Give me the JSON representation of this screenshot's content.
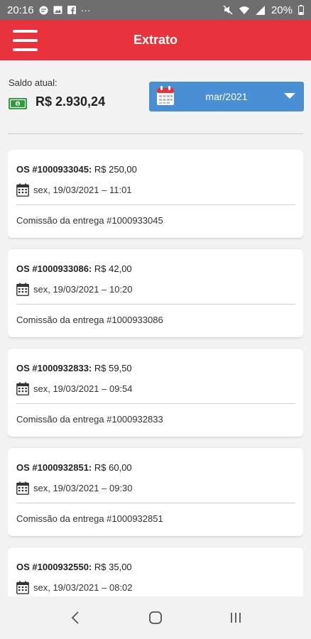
{
  "status_bar": {
    "time": "20:16",
    "more": "···",
    "battery": "20%"
  },
  "header": {
    "title": "Extrato"
  },
  "balance": {
    "label": "Saldo atual:",
    "value": "R$ 2.930,24"
  },
  "month_picker": {
    "selected": "mar/2021"
  },
  "entries": [
    {
      "os": "OS #1000933045:",
      "amount": "R$ 250,00",
      "date": "sex, 19/03/2021 – 11:01",
      "description": "Comissão da entrega #1000933045"
    },
    {
      "os": "OS #1000933086:",
      "amount": "R$ 42,00",
      "date": "sex, 19/03/2021 – 10:20",
      "description": "Comissão da entrega #1000933086"
    },
    {
      "os": "OS #1000932833:",
      "amount": "R$ 59,50",
      "date": "sex, 19/03/2021 – 09:54",
      "description": "Comissão da entrega #1000932833"
    },
    {
      "os": "OS #1000932851:",
      "amount": "R$ 60,00",
      "date": "sex, 19/03/2021 – 09:30",
      "description": "Comissão da entrega #1000932851"
    },
    {
      "os": "OS #1000932550:",
      "amount": "R$ 35,00",
      "date": "sex, 19/03/2021 – 08:02",
      "description": ""
    }
  ],
  "colors": {
    "header": "#e8323c",
    "picker": "#4a8fd4",
    "money": "#2e9a3b"
  },
  "icons": {
    "menu": "hamburger-menu-icon",
    "calendar": "calendar-icon",
    "money": "money-bill-icon",
    "dropdown": "caret-down-icon",
    "back": "back-icon",
    "home": "home-icon",
    "recents": "recents-icon"
  }
}
